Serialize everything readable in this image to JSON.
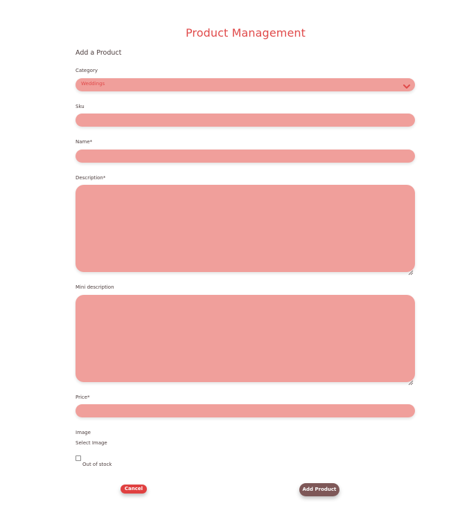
{
  "header": {
    "title": "Product Management"
  },
  "form": {
    "section_title": "Add a Product",
    "category": {
      "label": "Category",
      "value": "Weddings",
      "icon": "chevron-down-icon"
    },
    "sku": {
      "label": "Sku",
      "value": ""
    },
    "name": {
      "label": "Name*",
      "value": ""
    },
    "description": {
      "label": "Description*",
      "value": ""
    },
    "mini_description": {
      "label": "Mini description",
      "value": ""
    },
    "price": {
      "label": "Price*",
      "value": ""
    },
    "image": {
      "label": "Image",
      "select_text": "Select Image"
    },
    "out_of_stock": {
      "label": "Out of stock",
      "checked": false
    }
  },
  "actions": {
    "cancel_label": "Cancel",
    "add_label": "Add Product"
  },
  "colors": {
    "accent": "#e04a4a",
    "field_bg": "#f09f9b",
    "add_button": "#7e5858",
    "cancel_button": "#e04040",
    "text": "#4a3b3b"
  }
}
